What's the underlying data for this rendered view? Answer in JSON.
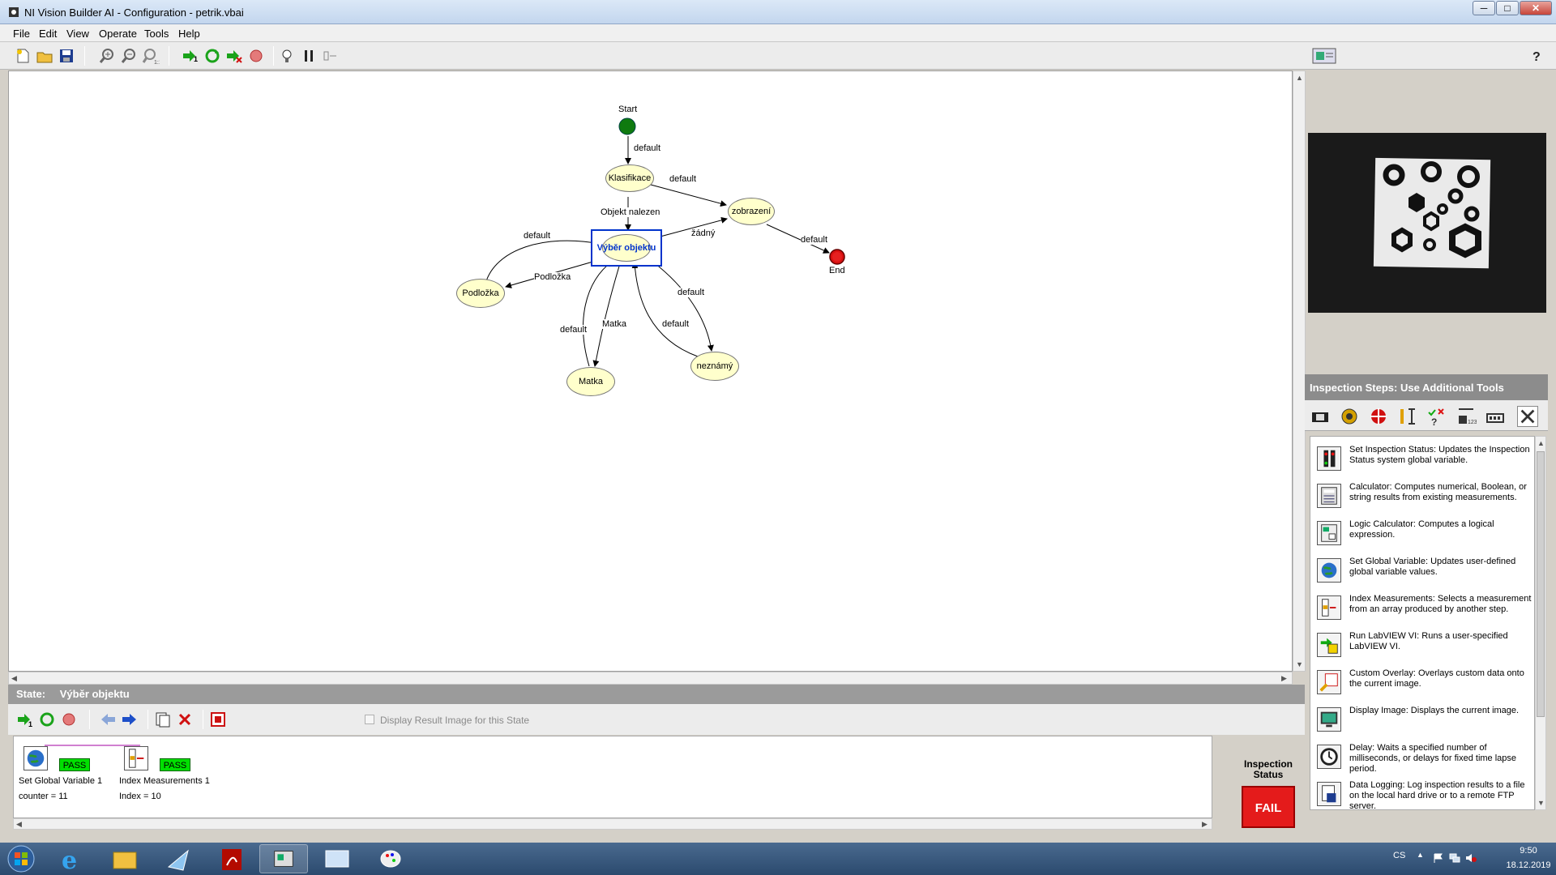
{
  "window": {
    "title": "NI Vision Builder AI - Configuration - petrik.vbai",
    "buttons": {
      "minimize": "─",
      "maximize": "□",
      "close": "✕"
    }
  },
  "menu": [
    "File",
    "Edit",
    "View",
    "Operate",
    "Tools",
    "Help"
  ],
  "toolbar": {
    "icons": [
      "new-file-icon",
      "open-folder-icon",
      "save-icon",
      "zoom-in-icon",
      "zoom-out-icon",
      "zoom-fit-icon",
      "run-once-icon",
      "run-continuous-icon",
      "run-to-end-icon",
      "stop-icon",
      "highlight-icon",
      "pause-icon",
      "step-icon",
      "image-view-icon",
      "help-icon"
    ]
  },
  "diagram": {
    "states": {
      "start": "Start",
      "end": "End",
      "klasifikace": "Klasifikace",
      "zobrazeni": "zobrazení",
      "vyber": "Výběr objektu",
      "podlozka": "Podložka",
      "matka": "Matka",
      "neznamy": "neznámý"
    },
    "transitions": {
      "start_klas": "default",
      "klas_zobr": "default",
      "klas_vyber": "Objekt nalezen",
      "vyber_zobr": "žádný",
      "zobr_end": "default",
      "podl_vyber": "default",
      "vyber_podl": "Podložka",
      "matka_vyber": "default",
      "vyber_matka": "Matka",
      "vyber_nezn": "default",
      "nezn_vyber": "default"
    }
  },
  "steps_panel": {
    "header": "Inspection Steps: Use Additional Tools",
    "tabs": [
      "acquire-image-icon",
      "enhance-image-icon",
      "locate-features-icon",
      "measure-features-icon",
      "check-presence-icon",
      "identify-parts-icon",
      "communicate-icon",
      "additional-tools-icon"
    ],
    "items": [
      {
        "icon": "traffic-light-icon",
        "text": "Set Inspection Status:  Updates the Inspection Status system global variable."
      },
      {
        "icon": "calculator-icon",
        "text": "Calculator:  Computes numerical, Boolean, or string results from existing measurements."
      },
      {
        "icon": "logic-calculator-icon",
        "text": "Logic Calculator:  Computes a logical expression."
      },
      {
        "icon": "globe-icon",
        "text": "Set Global Variable:  Updates user-defined global variable values."
      },
      {
        "icon": "index-measurements-icon",
        "text": "Index Measurements:  Selects a measurement from an array produced by another step."
      },
      {
        "icon": "run-vi-icon",
        "text": "Run LabVIEW VI:  Runs a user-specified LabVIEW VI."
      },
      {
        "icon": "custom-overlay-icon",
        "text": "Custom Overlay:  Overlays custom data onto the current image."
      },
      {
        "icon": "display-image-icon",
        "text": "Display Image:  Displays the current image."
      },
      {
        "icon": "delay-icon",
        "text": "Delay:  Waits a specified number of milliseconds, or delays for fixed time lapse period."
      },
      {
        "icon": "data-logging-icon",
        "text": "Data Logging:  Log inspection results to a file on the local hard drive or to a remote FTP server."
      }
    ]
  },
  "state_panel": {
    "label": "State:",
    "name": "Výběr objektu",
    "checkbox_label": "Display Result Image for this State",
    "steps": [
      {
        "name": "Set Global Variable 1",
        "detail": "counter = 11",
        "status": "PASS"
      },
      {
        "name": "Index Measurements 1",
        "detail": "Index = 10",
        "status": "PASS"
      }
    ]
  },
  "inspection_status": {
    "label": "Inspection Status",
    "value": "FAIL"
  },
  "taskbar": {
    "lang": "CS",
    "time": "9:50",
    "date": "18.12.2019"
  },
  "colors": {
    "state_fill": "#ffffcc",
    "selected": "#0033cc",
    "fail": "#e41b1b",
    "pass": "#00e000"
  }
}
